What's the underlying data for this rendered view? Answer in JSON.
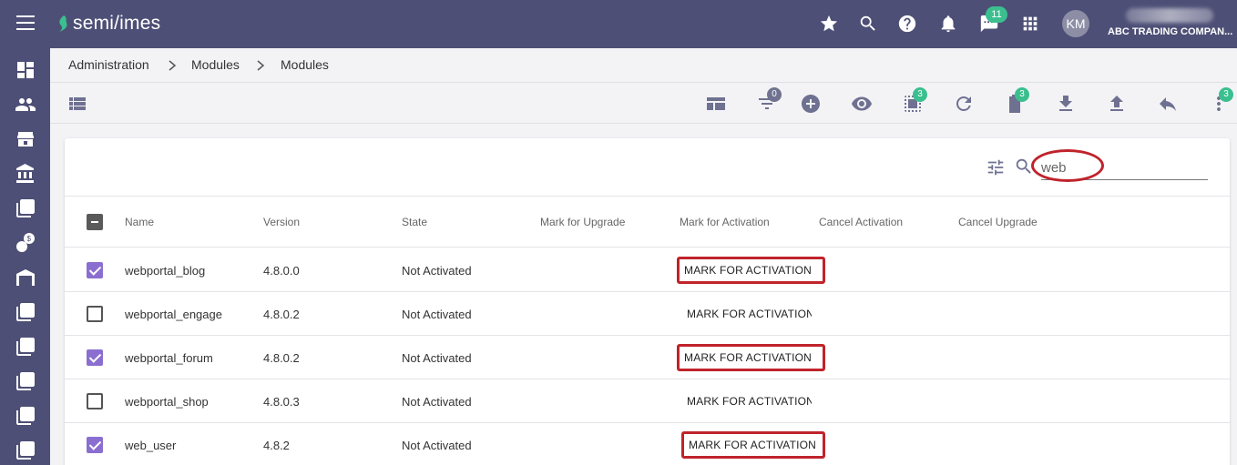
{
  "header": {
    "logo_text": "semi/imes",
    "chat_badge": "11",
    "avatar_initials": "KM",
    "company_name": "ABC TRADING COMPAN..."
  },
  "breadcrumb": [
    "Administration",
    "Modules",
    "Modules"
  ],
  "toolbar": {
    "filter_badge": "0",
    "copy_badge": "3",
    "clipboard_badge": "3",
    "more_badge": "3"
  },
  "search": {
    "value": "web",
    "placeholder": ""
  },
  "table": {
    "columns": [
      "Name",
      "Version",
      "State",
      "Mark for Upgrade",
      "Mark for Activation",
      "Cancel Activation",
      "Cancel Upgrade"
    ],
    "rows": [
      {
        "name": "webportal_blog",
        "version": "4.8.0.0",
        "state": "Not Activated",
        "action": "MARK FOR ACTIVATION",
        "checked": true
      },
      {
        "name": "webportal_engage",
        "version": "4.8.0.2",
        "state": "Not Activated",
        "action": "MARK FOR ACTIVATION",
        "checked": false
      },
      {
        "name": "webportal_forum",
        "version": "4.8.0.2",
        "state": "Not Activated",
        "action": "MARK FOR ACTIVATION",
        "checked": true
      },
      {
        "name": "webportal_shop",
        "version": "4.8.0.3",
        "state": "Not Activated",
        "action": "MARK FOR ACTIVATION",
        "checked": false
      },
      {
        "name": "web_user",
        "version": "4.8.2",
        "state": "Not Activated",
        "action": "MARK FOR ACTIVATION",
        "checked": true
      }
    ]
  },
  "colors": {
    "header_bg": "#4d4f76",
    "accent_green": "#3bbf8f",
    "checkbox_purple": "#8a6fd0",
    "annotation_red": "#c0232b"
  }
}
